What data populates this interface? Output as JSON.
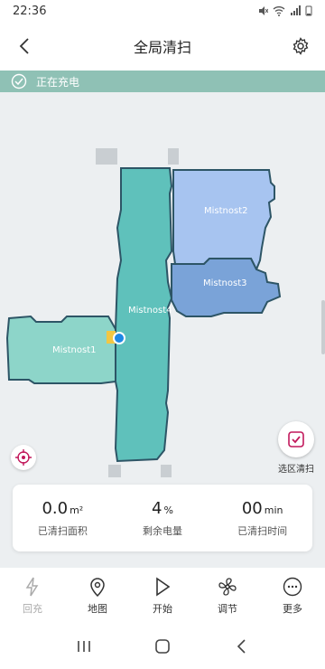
{
  "status_bar": {
    "time": "22:36"
  },
  "header": {
    "title": "全局清扫"
  },
  "banner": {
    "text": "正在充电"
  },
  "map": {
    "rooms": [
      {
        "name": "Mistnost1",
        "color": "#8dd5c9"
      },
      {
        "name": "Mistnost2",
        "color": "#a7c4f0"
      },
      {
        "name": "Mistnost3",
        "color": "#7aa3d8"
      },
      {
        "name": "Mistnost4",
        "color": "#5fc1bb"
      }
    ]
  },
  "zone_button": {
    "label": "选区清扫"
  },
  "stats": [
    {
      "value": "0.0",
      "unit": "m²",
      "label": "已清扫面积"
    },
    {
      "value": "4",
      "unit": "%",
      "label": "剩余电量"
    },
    {
      "value": "00",
      "unit": "min",
      "label": "已清扫时间"
    }
  ],
  "bottom_nav": [
    {
      "label": "回充",
      "icon": "lightning-icon"
    },
    {
      "label": "地图",
      "icon": "map-pin-icon"
    },
    {
      "label": "开始",
      "icon": "play-icon"
    },
    {
      "label": "调节",
      "icon": "fan-icon"
    },
    {
      "label": "更多",
      "icon": "more-icon"
    }
  ],
  "colors": {
    "accent": "#c2185b",
    "banner": "#8fc1b5",
    "room_outline": "#2d5566"
  }
}
